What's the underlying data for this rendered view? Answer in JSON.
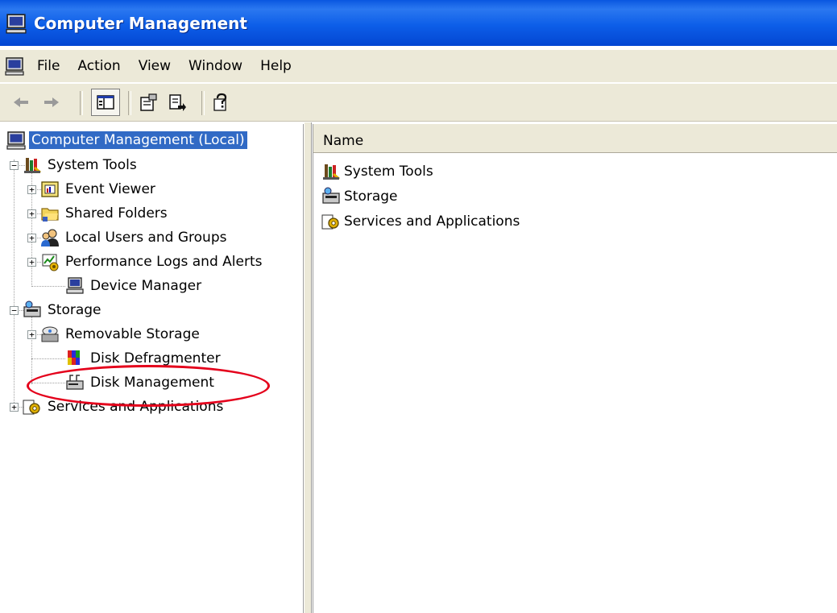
{
  "window": {
    "title": "Computer Management",
    "icon": "computer-management-icon"
  },
  "menu": {
    "items": [
      "File",
      "Action",
      "View",
      "Window",
      "Help"
    ]
  },
  "toolbar": {
    "buttons": [
      "back-arrow-icon",
      "forward-arrow-icon",
      "show-hide-console-tree-icon",
      "properties-icon",
      "export-list-icon",
      "help-icon"
    ]
  },
  "tree": {
    "root": "Computer Management (Local)",
    "system_tools": "System Tools",
    "event_viewer": "Event Viewer",
    "shared_folders": "Shared Folders",
    "local_users": "Local Users and Groups",
    "perf_logs": "Performance Logs and Alerts",
    "device_manager": "Device Manager",
    "storage": "Storage",
    "removable_storage": "Removable Storage",
    "disk_defrag": "Disk Defragmenter",
    "disk_management": "Disk Management",
    "services_apps": "Services and Applications"
  },
  "list": {
    "column_name": "Name",
    "items": [
      "System Tools",
      "Storage",
      "Services and Applications"
    ]
  },
  "colors": {
    "title_bar": "#0a57e0",
    "selection": "#316ac5",
    "annotation": "#e4001b",
    "chrome": "#ece9d8"
  }
}
